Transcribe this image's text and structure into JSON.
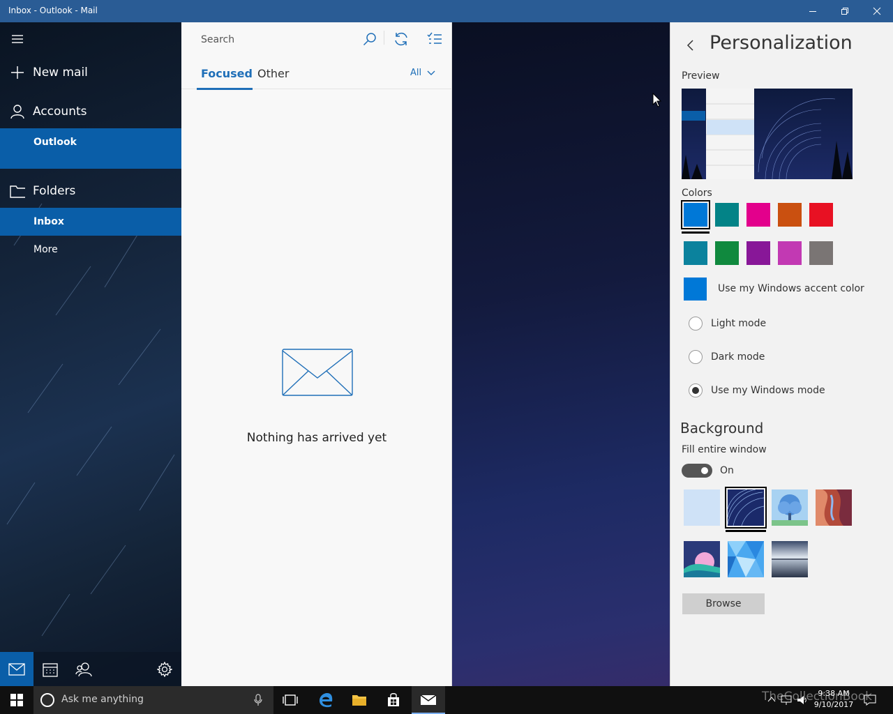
{
  "window": {
    "title": "Inbox - Outlook - Mail",
    "minimize_icon": "minimize-icon",
    "restore_icon": "restore-icon",
    "close_icon": "close-icon"
  },
  "nav": {
    "hamburger_icon": "hamburger-icon",
    "new_mail": "New mail",
    "accounts": "Accounts",
    "account_item": "Outlook",
    "folders": "Folders",
    "inbox": "Inbox",
    "more": "More",
    "bottom_icons": [
      "mail-icon",
      "calendar-icon",
      "people-icon",
      "settings-icon"
    ]
  },
  "message_list": {
    "search_placeholder": "Search",
    "tabs": [
      "Focused",
      "Other"
    ],
    "filter": "All",
    "empty_text": "Nothing has arrived yet"
  },
  "personalization": {
    "title": "Personalization",
    "preview_label": "Preview",
    "colors_label": "Colors",
    "colors": [
      "#0078d7",
      "#038387",
      "#e3008c",
      "#ca5010",
      "#e81123",
      "#0b829d",
      "#10893e",
      "#881798",
      "#c239b3",
      "#7a7574"
    ],
    "selected_color_index": 0,
    "accent_color": "#0078d7",
    "accent_label": "Use my Windows accent color",
    "modes": [
      {
        "label": "Light mode",
        "selected": false
      },
      {
        "label": "Dark mode",
        "selected": false
      },
      {
        "label": "Use my Windows mode",
        "selected": true
      }
    ],
    "background_title": "Background",
    "fill_label": "Fill entire window",
    "fill_state": "On",
    "selected_background_index": 1,
    "browse_label": "Browse"
  },
  "taskbar": {
    "search_placeholder": "Ask me anything",
    "time": "9:38 AM",
    "date": "9/10/2017",
    "watermark": "TheCollectionBook"
  }
}
